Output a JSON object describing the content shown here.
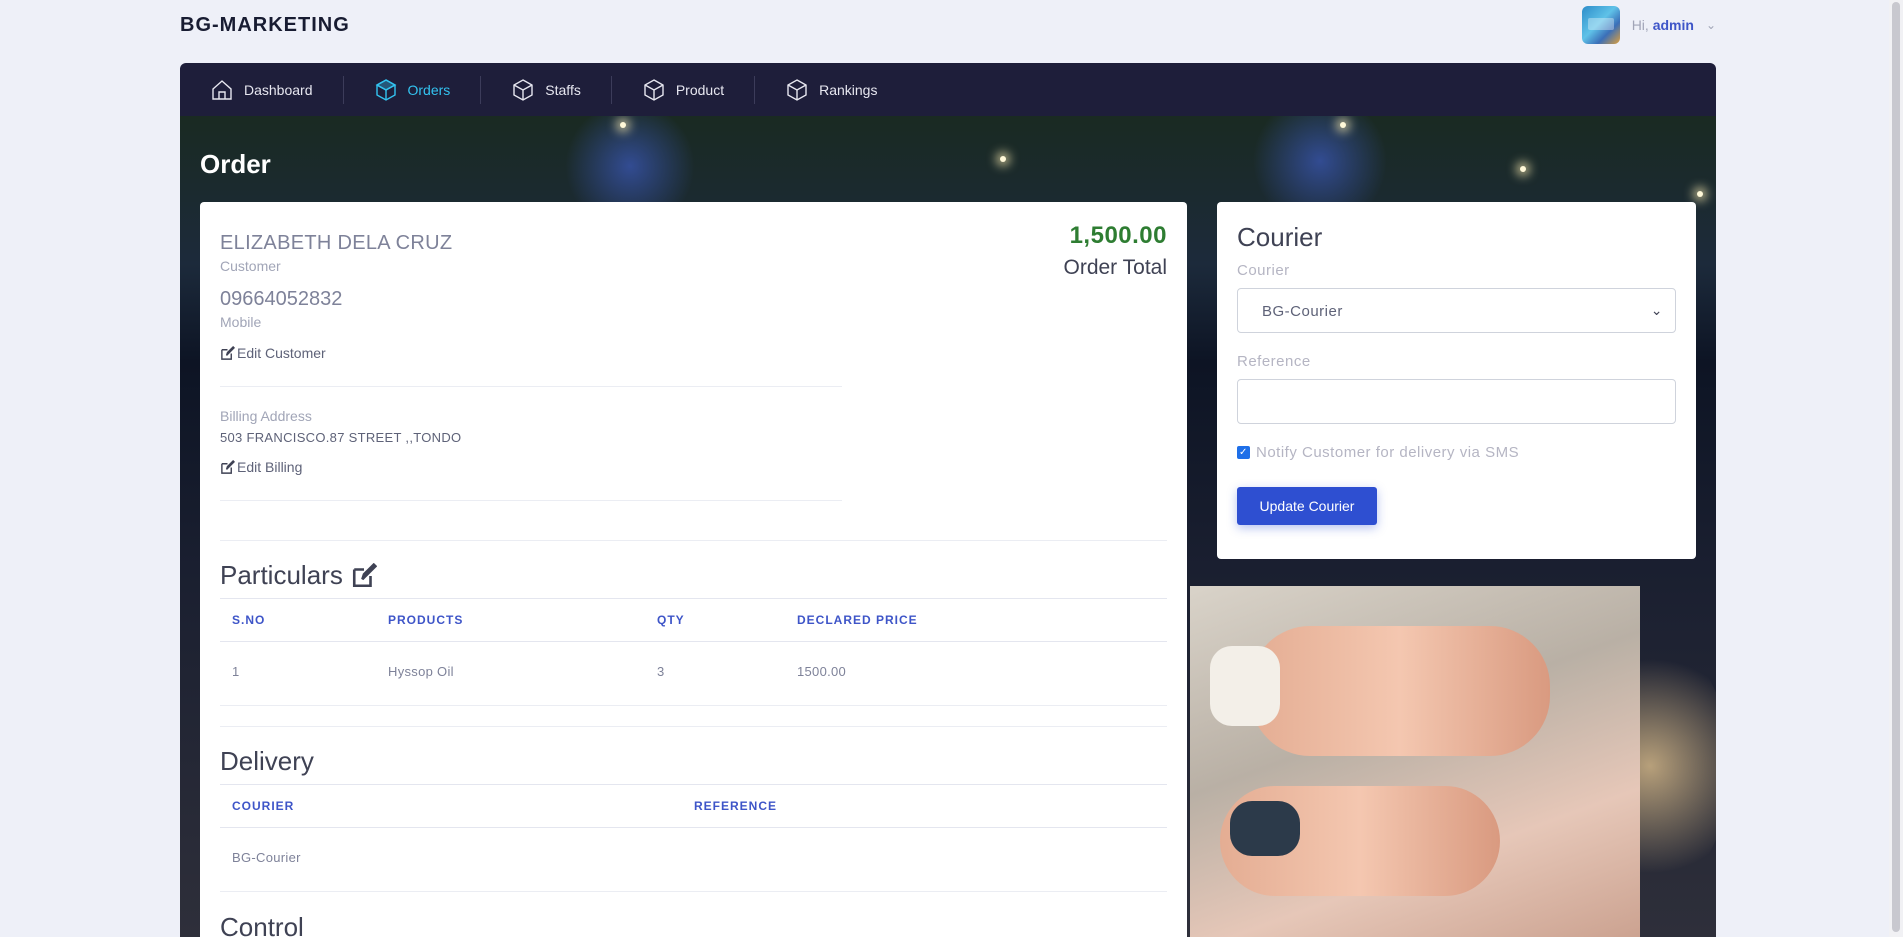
{
  "header": {
    "brand": "BG-MARKETING",
    "greeting": "Hi,",
    "username": "admin"
  },
  "nav": {
    "items": [
      {
        "label": "Dashboard",
        "icon": "home-icon"
      },
      {
        "label": "Orders",
        "icon": "cube-icon",
        "active": true
      },
      {
        "label": "Staffs",
        "icon": "cube-icon"
      },
      {
        "label": "Product",
        "icon": "cube-icon"
      },
      {
        "label": "Rankings",
        "icon": "cube-icon"
      }
    ]
  },
  "page": {
    "title": "Order"
  },
  "customer": {
    "name": "ELIZABETH DELA CRUZ",
    "name_label": "Customer",
    "mobile": "09664052832",
    "mobile_label": "Mobile",
    "edit_label": "Edit Customer",
    "billing_label": "Billing Address",
    "billing_address": "503 FRANCISCO.87 STREET ,,TONDO",
    "edit_billing_label": "Edit Billing"
  },
  "order": {
    "total": "1,500.00",
    "total_label": "Order Total"
  },
  "particulars": {
    "title": "Particulars",
    "columns": [
      "S.NO",
      "PRODUCTS",
      "QTY",
      "DECLARED PRICE"
    ],
    "rows": [
      [
        "1",
        "Hyssop Oil",
        "3",
        "1500.00"
      ]
    ]
  },
  "delivery": {
    "title": "Delivery",
    "columns": [
      "COURIER",
      "REFERENCE"
    ],
    "rows": [
      [
        "BG-Courier",
        ""
      ]
    ]
  },
  "control": {
    "title": "Control"
  },
  "courier_panel": {
    "title": "Courier",
    "courier_label": "Courier",
    "courier_value": "BG-Courier",
    "reference_label": "Reference",
    "reference_value": "",
    "notify_label": "Notify Customer for delivery via SMS",
    "notify_checked": true,
    "button_label": "Update Courier"
  },
  "colors": {
    "nav_bg": "#1e1e3a",
    "active": "#33c3f0",
    "primary": "#2e4fd1",
    "total": "#2e7d32",
    "table_head": "#3e55c8"
  }
}
